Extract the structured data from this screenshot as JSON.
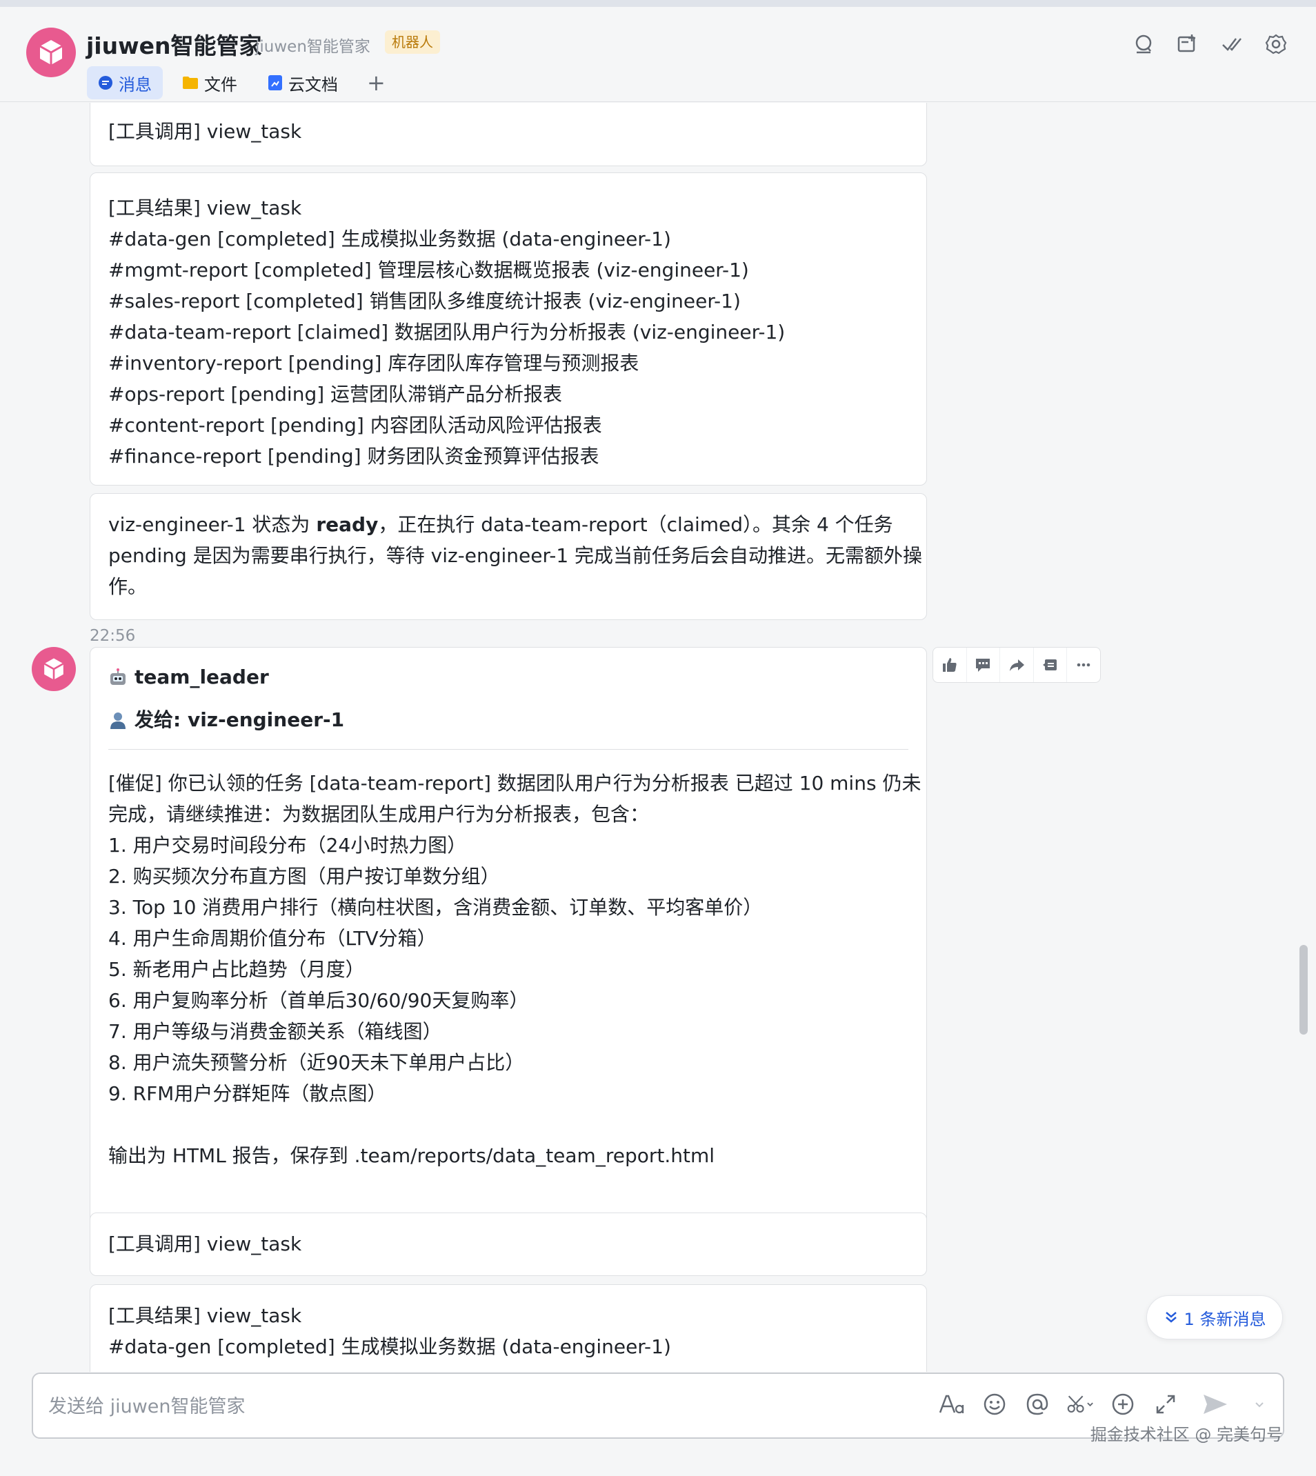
{
  "header": {
    "title": "jiuwen智能管家",
    "subtitle": "jiuwen智能管家",
    "badge": "机器人",
    "tabs": [
      {
        "label": "消息",
        "icon": "message-icon"
      },
      {
        "label": "文件",
        "icon": "folder-icon"
      },
      {
        "label": "云文档",
        "icon": "doc-icon"
      }
    ],
    "add_tab": "+",
    "icons": [
      "search-icon",
      "new-topic-icon",
      "done-icon",
      "settings-icon"
    ]
  },
  "messages": {
    "tool_call_1": "[工具调用] view_task",
    "tool_result_1": [
      "[工具结果] view_task",
      "#data-gen [completed] 生成模拟业务数据 (data-engineer-1)",
      "#mgmt-report [completed] 管理层核心数据概览报表 (viz-engineer-1)",
      "#sales-report [completed] 销售团队多维度统计报表 (viz-engineer-1)",
      "#data-team-report [claimed] 数据团队用户行为分析报表 (viz-engineer-1)",
      "#inventory-report [pending] 库存团队库存管理与预测报表",
      "#ops-report [pending] 运营团队滞销产品分析报表",
      "#content-report [pending] 内容团队活动风险评估报表",
      "#finance-report [pending] 财务团队资金预算评估报表"
    ],
    "status": {
      "pre": "viz-engineer-1 状态为 ",
      "bold": "ready",
      "post1": "，正在执行 data-team-report（claimed）。其余 4 个任务",
      "line2": "pending 是因为需要串行执行，等待 viz-engineer-1 完成当前任务后会自动推进。无需额外操",
      "line3": "作。"
    },
    "timestamp": "22:56",
    "sender": "team_leader",
    "sender_icon": "robot-icon",
    "recipient": "发给: viz-engineer-1",
    "recipient_icon": "user-icon",
    "reminder_lines": [
      "[催促] 你已认领的任务 [data-team-report] 数据团队用户行为分析报表 已超过 10 mins 仍未",
      "完成，请继续推进：为数据团队生成用户行为分析报表，包含：",
      "1. 用户交易时间段分布（24小时热力图）",
      "2. 购买频次分布直方图（用户按订单数分组）",
      "3. Top 10 消费用户排行（横向柱状图，含消费金额、订单数、平均客单价）",
      "4. 用户生命周期价值分布（LTV分箱）",
      "5. 新老用户占比趋势（月度）",
      "6. 用户复购率分析（首单后30/60/90天复购率）",
      "7. 用户等级与消费金额关系（箱线图）",
      "8. 用户流失预警分析（近90天未下单用户占比）",
      "9. RFM用户分群矩阵（散点图）"
    ],
    "reminder_output": "输出为 HTML 报告，保存到 .team/reports/data_team_report.html",
    "tool_call_2": "[工具调用] view_task",
    "tool_result_2": [
      "[工具结果] view_task",
      "#data-gen [completed] 生成模拟业务数据 (data-engineer-1)"
    ],
    "actions": [
      "thumbs-up-icon",
      "reply-icon",
      "forward-icon",
      "quote-icon",
      "more-icon"
    ]
  },
  "new_message_pill": "1 条新消息",
  "composer": {
    "placeholder": "发送给 jiuwen智能管家",
    "icons": [
      "font-icon",
      "emoji-icon",
      "mention-icon",
      "scissors-icon",
      "plus-circle-icon",
      "expand-icon",
      "send-icon"
    ]
  },
  "watermark": "掘金技术社区 @ 完美句号"
}
